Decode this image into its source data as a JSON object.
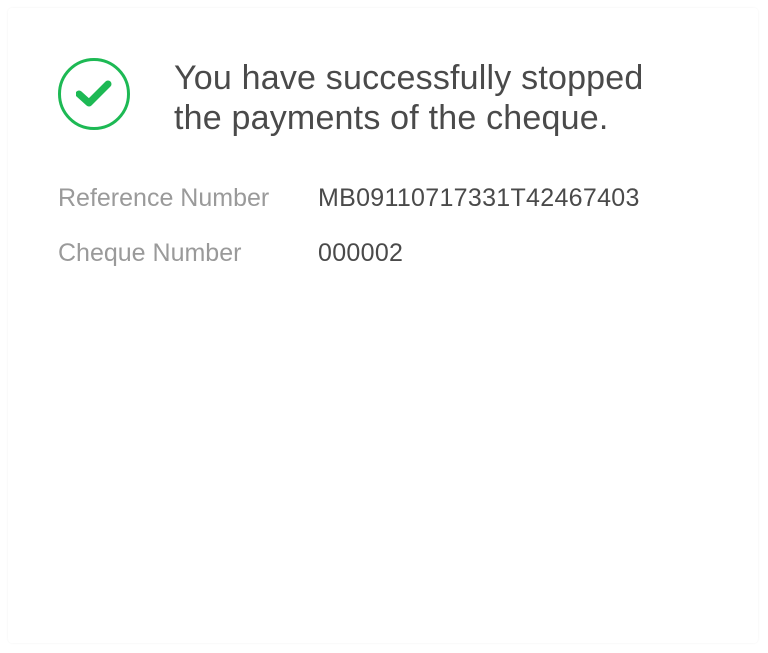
{
  "confirmation": {
    "message": "You have successfully stopped the payments of the cheque.",
    "icon": "check-circle-icon",
    "accent_color": "#1db954"
  },
  "details": [
    {
      "label": "Reference Number",
      "value": "MB09110717331T42467403"
    },
    {
      "label": "Cheque Number",
      "value": "000002"
    }
  ]
}
